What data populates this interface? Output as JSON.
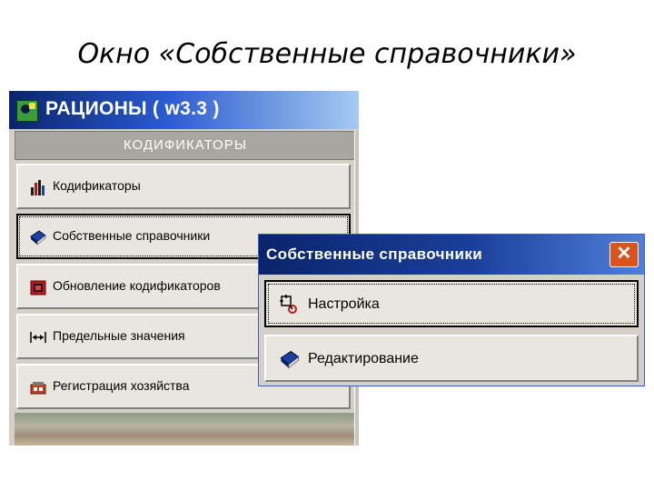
{
  "slide": {
    "title": "Окно «Собственные справочники»"
  },
  "main_window": {
    "title": "РАЦИОНЫ ( w3.3 )",
    "section_header": "КОДИФИКАТОРЫ",
    "items": [
      {
        "label": "Кодификаторы",
        "icon": "bar-chart-icon"
      },
      {
        "label": "Собственные справочники",
        "icon": "book-icon"
      },
      {
        "label": "Обновление кодификаторов",
        "icon": "update-icon"
      },
      {
        "label": "Предельные значения",
        "icon": "range-arrows-icon"
      },
      {
        "label": "Регистрация хозяйства",
        "icon": "register-icon"
      }
    ]
  },
  "dialog": {
    "title": "Собственные справочники",
    "close_glyph": "✕",
    "buttons": [
      {
        "label": "Настройка",
        "icon": "settings-icon"
      },
      {
        "label": "Редактирование",
        "icon": "book-icon"
      }
    ]
  },
  "colors": {
    "titlebar": "#0a246a",
    "close": "#d9531e",
    "face": "#d4d0c8"
  }
}
